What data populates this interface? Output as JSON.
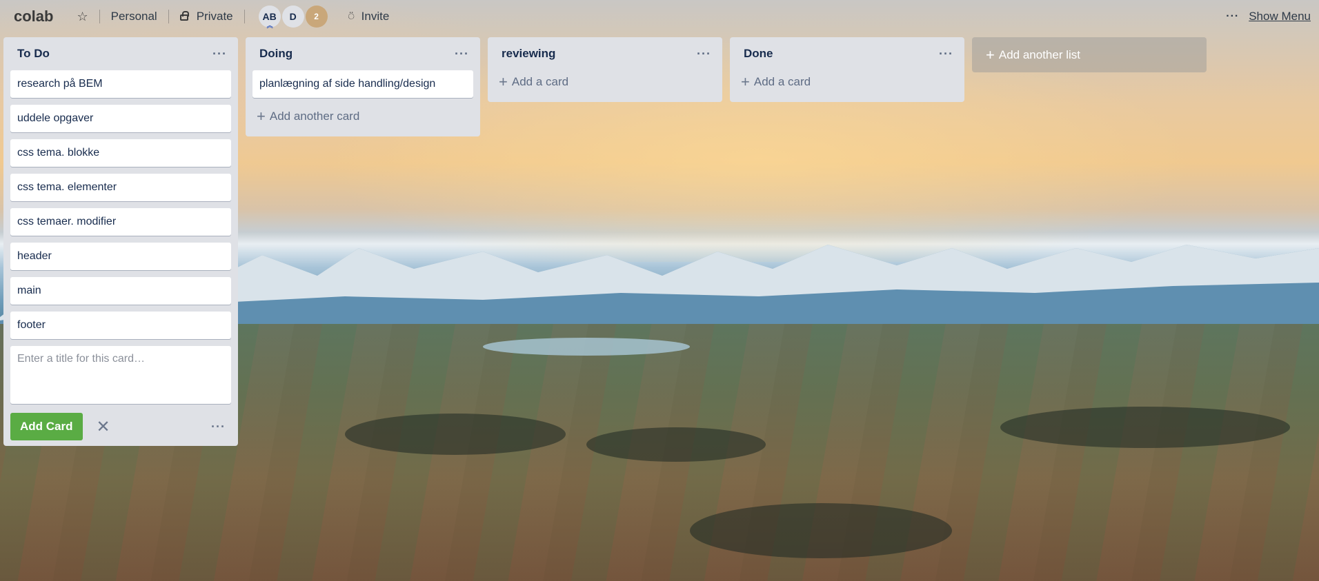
{
  "header": {
    "board_title": "colab",
    "star_icon": "star-icon",
    "visibility_team": "Personal",
    "visibility_privacy": "Private",
    "members": [
      "AB",
      "D"
    ],
    "member_count": "2",
    "invite_label": "Invite",
    "show_menu_label": "Show Menu",
    "dots": "···"
  },
  "lists": [
    {
      "title": "To Do",
      "cards": [
        "research på BEM",
        "uddele opgaver",
        "css tema. blokke",
        "css tema. elementer",
        "css temaer. modifier",
        "header",
        "main",
        "footer"
      ],
      "composer": {
        "placeholder": "Enter a title for this card…",
        "add_button": "Add Card",
        "close": "✕",
        "more": "···"
      }
    },
    {
      "title": "Doing",
      "cards": [
        "planlægning af side handling/design"
      ],
      "add_label": "Add another card"
    },
    {
      "title": "reviewing",
      "cards": [],
      "add_label": "Add a card"
    },
    {
      "title": "Done",
      "cards": [],
      "add_label": "Add a card"
    }
  ],
  "add_list_label": "Add another list",
  "menu_dots": "···",
  "colors": {
    "list_bg": "#dfe1e6",
    "add_button_green": "#5aac44",
    "text_dark": "#172b4d"
  }
}
